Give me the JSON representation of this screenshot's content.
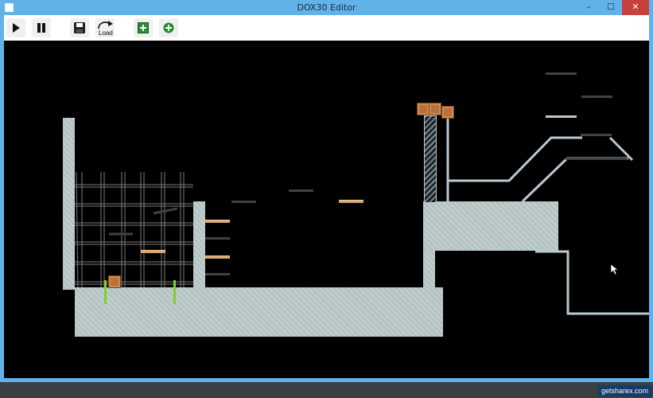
{
  "window": {
    "title": "DOX30 Editor",
    "controls": {
      "minimize": "–",
      "maximize": "☐",
      "close": "✕"
    }
  },
  "toolbar": {
    "play_icon": "play-icon",
    "pause_icon": "pause-icon",
    "save_icon": "save-icon",
    "load_label": "Load",
    "add_block_icon": "add-block-icon",
    "add_item_icon": "add-circle-icon"
  },
  "colors": {
    "titlebar": "#62b2ea",
    "canvas": "#000000",
    "concrete": "#bccaca",
    "plank": "#d6a46c",
    "crate": "#b8713a",
    "spring": "#7ed321",
    "close_button": "#c7413a"
  },
  "watermark": "getsharex.com"
}
